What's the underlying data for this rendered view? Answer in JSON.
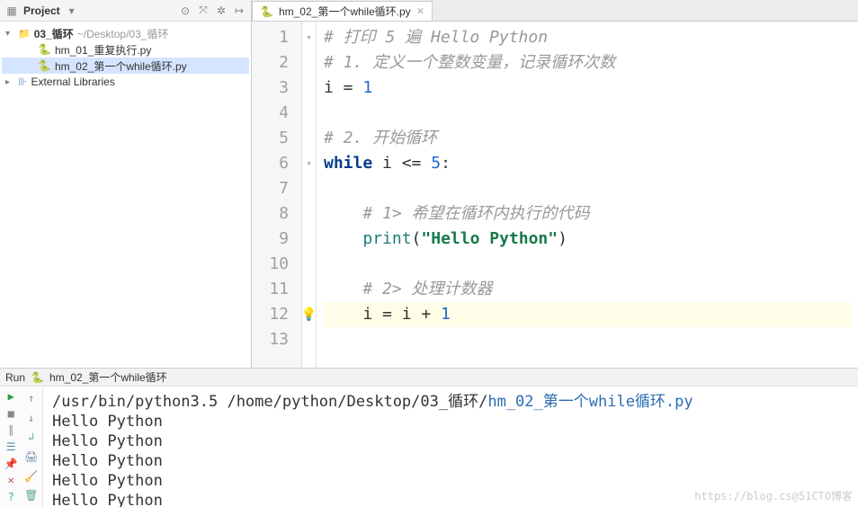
{
  "sidebar": {
    "title": "Project",
    "root": {
      "label": "03_循环",
      "path": "~/Desktop/03_循环"
    },
    "files": [
      {
        "label": "hm_01_重复执行.py",
        "selected": false
      },
      {
        "label": "hm_02_第一个while循环.py",
        "selected": true
      }
    ],
    "external_libs": "External Libraries"
  },
  "editor": {
    "tab": "hm_02_第一个while循环.py",
    "lines": [
      {
        "n": 1,
        "tokens": [
          {
            "t": "# 打印 5 遍 Hello Python",
            "c": "comment"
          }
        ]
      },
      {
        "n": 2,
        "tokens": [
          {
            "t": "# 1. 定义一个整数变量，记录循环次数",
            "c": "comment"
          }
        ]
      },
      {
        "n": 3,
        "tokens": [
          {
            "t": "i = ",
            "c": ""
          },
          {
            "t": "1",
            "c": "num"
          }
        ]
      },
      {
        "n": 4,
        "tokens": [
          {
            "t": "",
            "c": ""
          }
        ]
      },
      {
        "n": 5,
        "tokens": [
          {
            "t": "# 2. 开始循环",
            "c": "comment"
          }
        ]
      },
      {
        "n": 6,
        "tokens": [
          {
            "t": "while",
            "c": "kw"
          },
          {
            "t": " i <= ",
            "c": ""
          },
          {
            "t": "5",
            "c": "num"
          },
          {
            "t": ":",
            "c": ""
          }
        ]
      },
      {
        "n": 7,
        "tokens": [
          {
            "t": "",
            "c": ""
          }
        ]
      },
      {
        "n": 8,
        "tokens": [
          {
            "t": "    ",
            "c": ""
          },
          {
            "t": "# 1> 希望在循环内执行的代码",
            "c": "comment"
          }
        ]
      },
      {
        "n": 9,
        "tokens": [
          {
            "t": "    ",
            "c": ""
          },
          {
            "t": "print",
            "c": "fn"
          },
          {
            "t": "(",
            "c": ""
          },
          {
            "t": "\"Hello Python\"",
            "c": "str"
          },
          {
            "t": ")",
            "c": ""
          }
        ]
      },
      {
        "n": 10,
        "tokens": [
          {
            "t": "",
            "c": ""
          }
        ]
      },
      {
        "n": 11,
        "tokens": [
          {
            "t": "    ",
            "c": ""
          },
          {
            "t": "# 2> 处理计数器",
            "c": "comment"
          }
        ]
      },
      {
        "n": 12,
        "tokens": [
          {
            "t": "    i = i + ",
            "c": ""
          },
          {
            "t": "1",
            "c": "num"
          }
        ],
        "cursor": true,
        "bulb": true
      },
      {
        "n": 13,
        "tokens": [
          {
            "t": "",
            "c": ""
          }
        ]
      }
    ]
  },
  "run": {
    "label": "Run",
    "config": "hm_02_第一个while循环",
    "cmd_prefix": "/usr/bin/python3.5 /home/python/Desktop/03_循环/",
    "cmd_hl": "hm_02_第一个while循环.py",
    "out_line": "Hello Python",
    "out_count": 5
  },
  "watermark": "https://blog.cs@51CTO博客"
}
